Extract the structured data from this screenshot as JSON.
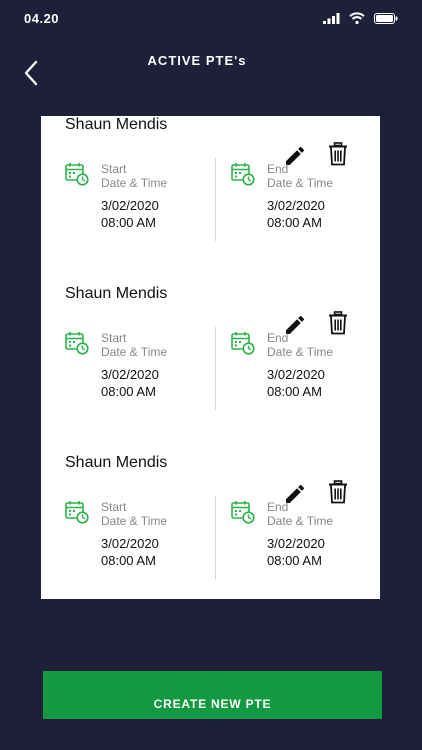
{
  "status_bar": {
    "time": "04.20"
  },
  "header": {
    "title": "ACTIVE PTE's"
  },
  "entries": [
    {
      "name": "Shaun Mendis",
      "start": {
        "label": "Start",
        "sublabel": "Date & Time",
        "date": "3/02/2020",
        "time": "08:00 AM"
      },
      "end": {
        "label": "End",
        "sublabel": "Date & Time",
        "date": "3/02/2020",
        "time": "08:00 AM"
      }
    },
    {
      "name": "Shaun Mendis",
      "start": {
        "label": "Start",
        "sublabel": "Date & Time",
        "date": "3/02/2020",
        "time": "08:00 AM"
      },
      "end": {
        "label": "End",
        "sublabel": "Date & Time",
        "date": "3/02/2020",
        "time": "08:00 AM"
      }
    },
    {
      "name": "Shaun Mendis",
      "start": {
        "label": "Start",
        "sublabel": "Date & Time",
        "date": "3/02/2020",
        "time": "08:00 AM"
      },
      "end": {
        "label": "End",
        "sublabel": "Date & Time",
        "date": "3/02/2020",
        "time": "08:00 AM"
      }
    }
  ],
  "footer": {
    "create_label": "CREATE NEW PTE"
  },
  "colors": {
    "background": "#1d2038",
    "accent": "#129a42",
    "card": "#ffffff"
  },
  "icons": {
    "back": "chevron-left-icon",
    "edit": "pencil-icon",
    "delete": "trash-icon",
    "calendar": "calendar-clock-icon"
  }
}
